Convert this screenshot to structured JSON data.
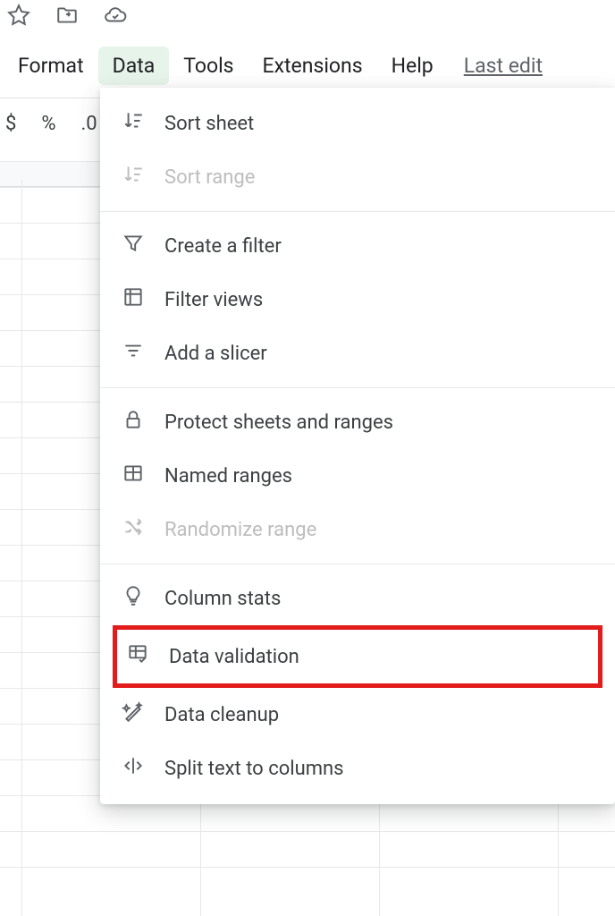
{
  "menubar": {
    "format": "Format",
    "data": "Data",
    "tools": "Tools",
    "extensions": "Extensions",
    "help": "Help",
    "last_edit": "Last edit"
  },
  "toolbar": {
    "currency": "$",
    "percent": "%",
    "decimal_decrease": ".0"
  },
  "dropdown": {
    "sort_sheet": "Sort sheet",
    "sort_range": "Sort range",
    "create_filter": "Create a filter",
    "filter_views": "Filter views",
    "add_slicer": "Add a slicer",
    "protect": "Protect sheets and ranges",
    "named_ranges": "Named ranges",
    "randomize": "Randomize range",
    "column_stats": "Column stats",
    "data_validation": "Data validation",
    "data_cleanup": "Data cleanup",
    "split_text": "Split text to columns"
  }
}
